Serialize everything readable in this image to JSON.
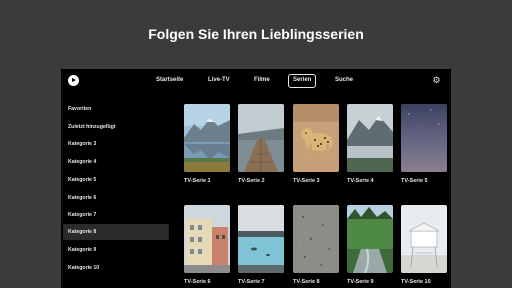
{
  "headline": "Folgen Sie Ihren Lieblingsserien",
  "nav": {
    "items": [
      "Startseite",
      "Live-TV",
      "Filme",
      "Serien",
      "Suche"
    ],
    "active": "Serien"
  },
  "sidebar": {
    "items": [
      "Favoriten",
      "Zuletzt hinzugefügt",
      "Kategorie 3",
      "Kategorie 4",
      "Kategorie 5",
      "Kategorie 6",
      "Kategorie 7",
      "Kategorie 8",
      "Kategorie 9",
      "Kategorie 10"
    ],
    "selected": "Kategorie 8"
  },
  "cards": [
    {
      "title": "TV-Serie 1",
      "thumb": "mountain-lake"
    },
    {
      "title": "TV-Serie 2",
      "thumb": "boardwalk"
    },
    {
      "title": "TV-Serie 3",
      "thumb": "leopard"
    },
    {
      "title": "TV-Serie 4",
      "thumb": "misty-mountains"
    },
    {
      "title": "TV-Serie 5",
      "thumb": "night-sky"
    },
    {
      "title": "TV-Serie 6",
      "thumb": "houses"
    },
    {
      "title": "TV-Serie 7",
      "thumb": "hot-spring"
    },
    {
      "title": "TV-Serie 8",
      "thumb": "sand"
    },
    {
      "title": "TV-Serie 9",
      "thumb": "forest-river"
    },
    {
      "title": "TV-Serie 10",
      "thumb": "lifeguard-tower"
    }
  ],
  "icons": {
    "logo": "play-logo-icon",
    "settings": "gear-icon"
  }
}
